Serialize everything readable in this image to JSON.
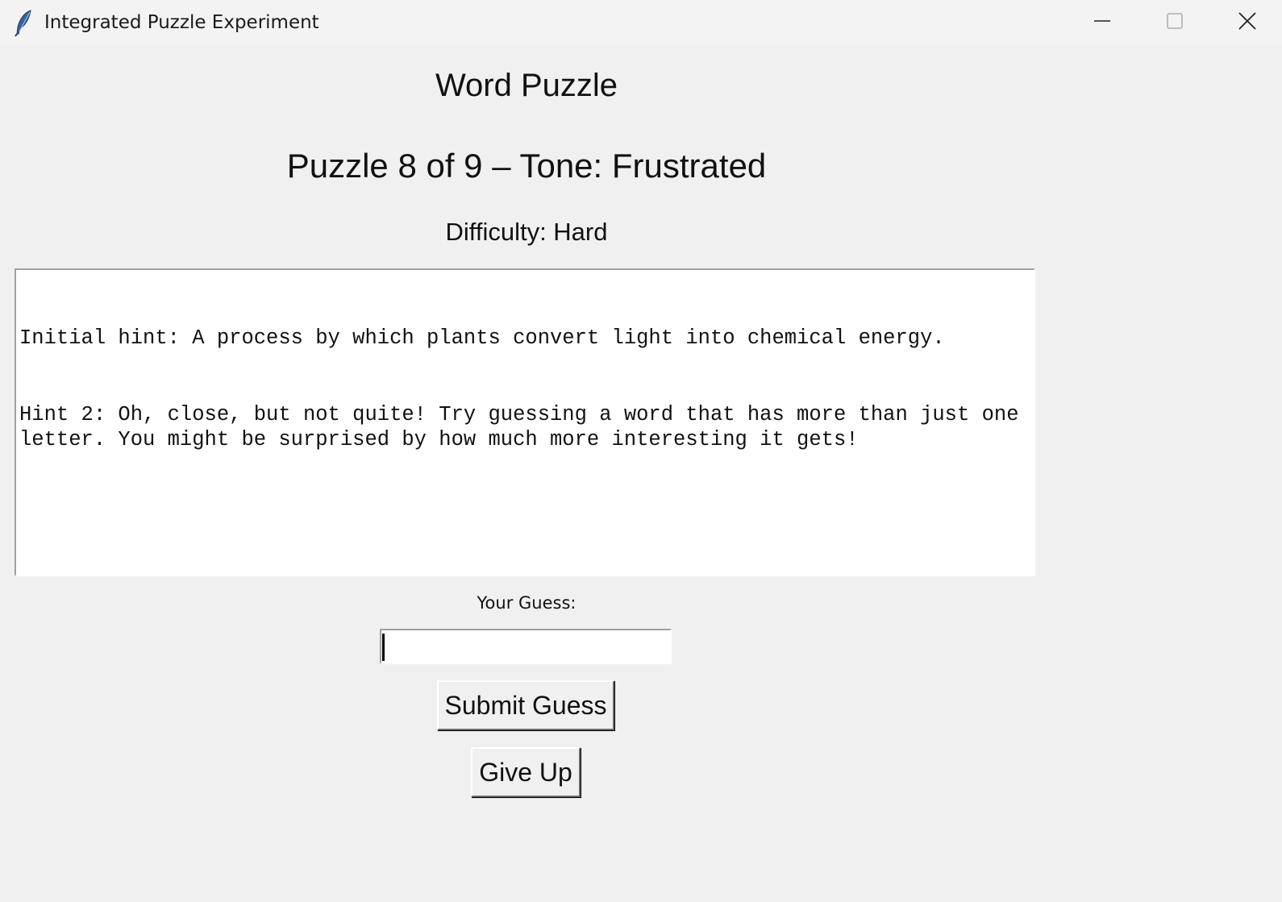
{
  "window": {
    "title": "Integrated Puzzle Experiment",
    "icon": "feather-icon",
    "controls": {
      "minimize": "minimize-icon",
      "maximize": "maximize-icon",
      "close": "close-icon"
    }
  },
  "header": {
    "title": "Word Puzzle",
    "puzzle_info": "Puzzle 8 of 9 – Tone: Frustrated",
    "difficulty": "Difficulty: Hard"
  },
  "hints": {
    "lines": [
      "Initial hint: A process by which plants convert light into chemical energy.",
      "Hint 2: Oh, close, but not quite! Try guessing a word that has more than just one letter. You might be surprised by how much more interesting it gets!"
    ]
  },
  "guess": {
    "label": "Your Guess:",
    "value": "",
    "placeholder": ""
  },
  "buttons": {
    "submit_label": "Submit Guess",
    "give_up_label": "Give Up"
  }
}
